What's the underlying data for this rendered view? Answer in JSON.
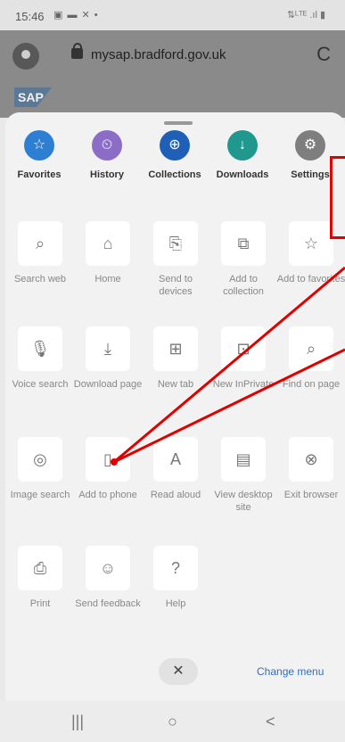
{
  "status_bar": {
    "time": "15:46",
    "notif_icons": "▣ ▬ ✕ •",
    "sys_icons": "⇅ᴸᵀᴱ .ıl ▮"
  },
  "url_bar": {
    "url": "mysap.bradford.gov.uk"
  },
  "page": {
    "logo_text": "SAP"
  },
  "favorites_row": [
    {
      "label": "Favorites",
      "icon": "star-icon",
      "glyph": "☆",
      "color": "#2d7fd3"
    },
    {
      "label": "History",
      "icon": "history-icon",
      "glyph": "⏲",
      "color": "#8b6cc7"
    },
    {
      "label": "Collections",
      "icon": "collections-icon",
      "glyph": "⊕",
      "color": "#1f5fb8"
    },
    {
      "label": "Downloads",
      "icon": "download-icon",
      "glyph": "↓",
      "color": "#21988e"
    },
    {
      "label": "Settings",
      "icon": "gear-icon",
      "glyph": "⚙",
      "color": "#7e7e7e"
    }
  ],
  "menu_items": [
    {
      "label": "Search web",
      "icon": "search-icon",
      "glyph": "⌕"
    },
    {
      "label": "Home",
      "icon": "home-icon",
      "glyph": "⌂"
    },
    {
      "label": "Send to devices",
      "icon": "send-to-devices-icon",
      "glyph": "⎘"
    },
    {
      "label": "Add to collection",
      "icon": "add-to-collection-icon",
      "glyph": "⧉"
    },
    {
      "label": "Add to favorites",
      "icon": "add-favorite-icon",
      "glyph": "☆"
    },
    {
      "label": "Voice search",
      "icon": "microphone-icon",
      "glyph": "🎙"
    },
    {
      "label": "Download page",
      "icon": "download-page-icon",
      "glyph": "⤓"
    },
    {
      "label": "New tab",
      "icon": "new-tab-icon",
      "glyph": "⊞"
    },
    {
      "label": "New InPrivate",
      "icon": "inprivate-icon",
      "glyph": "⊡"
    },
    {
      "label": "Find on page",
      "icon": "find-on-page-icon",
      "glyph": "⌕"
    },
    {
      "label": "Image search",
      "icon": "camera-icon",
      "glyph": "◎"
    },
    {
      "label": "Add to phone",
      "icon": "add-to-phone-icon",
      "glyph": "▯"
    },
    {
      "label": "Read aloud",
      "icon": "read-aloud-icon",
      "glyph": "A"
    },
    {
      "label": "View desktop site",
      "icon": "desktop-icon",
      "glyph": "▤"
    },
    {
      "label": "Exit browser",
      "icon": "exit-icon",
      "glyph": "⊗"
    },
    {
      "label": "Print",
      "icon": "print-icon",
      "glyph": "⎙"
    },
    {
      "label": "Send feedback",
      "icon": "feedback-icon",
      "glyph": "☺"
    },
    {
      "label": "Help",
      "icon": "help-icon",
      "glyph": "?"
    }
  ],
  "bottom": {
    "close_glyph": "✕",
    "change_menu": "Change menu"
  },
  "nav_bar": {
    "recent": "|||",
    "home": "○",
    "back": "<"
  }
}
